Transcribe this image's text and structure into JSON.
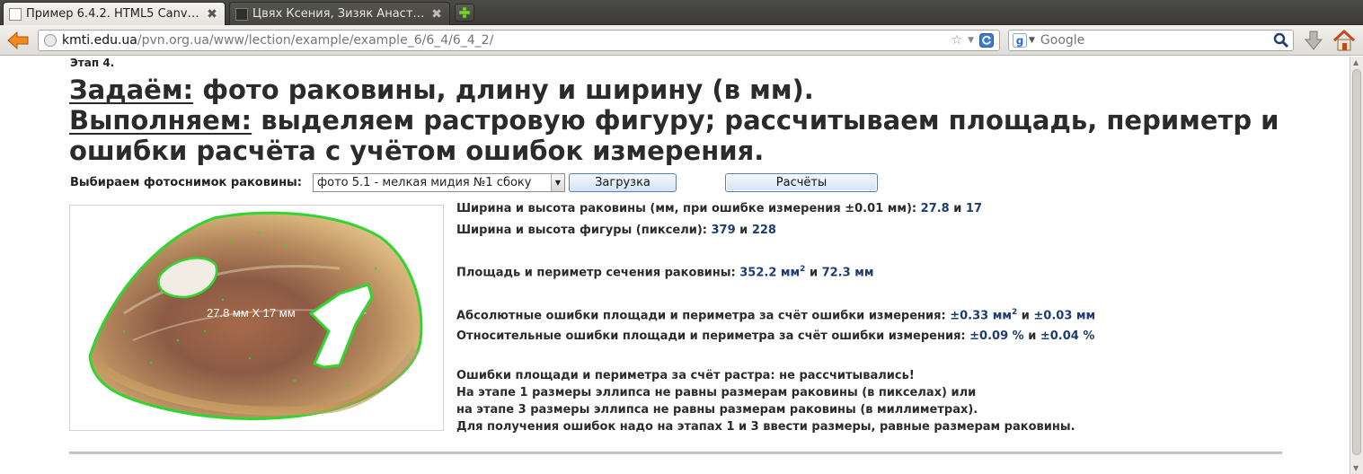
{
  "browser": {
    "tabs": [
      {
        "label": "Пример 6.4.2. HTML5 Canv…",
        "active": true
      },
      {
        "label": "Цвях Ксения, Зизяк Анаст…",
        "active": false
      }
    ],
    "url_host": "kmti.edu.ua",
    "url_path": "/pvn.org.ua/www/lection/example/example_6/6_4/6_4_2/",
    "search_engine": "google-icon",
    "search_placeholder": "Google"
  },
  "page": {
    "stage": "Этап 4.",
    "heading": {
      "task_kw": "Задаём:",
      "task_text": " фото раковины, длину и ширину (в мм).",
      "do_kw": "Выполняем:",
      "do_text": " выделяем растровую фигуру; рассчитываем площадь, периметр и",
      "do_text2": "ошибки расчёта с учётом ошибок измерения."
    },
    "controls": {
      "choose_label": "Выбираем фотоснимок раковины:",
      "selected_photo": "фото 5.1 - мелкая мидия №1 сбоку",
      "load_button": "Загрузка",
      "calc_button": "Расчёты"
    },
    "photo": {
      "overlay_text": "27.8 мм X 17 мм",
      "outline_color": "#2fd62f"
    },
    "results": {
      "shell_size_label": "Ширина и высота раковины (мм, при ошибке измерения ±0.01 мм): ",
      "shell_w": "27.8",
      "and": " и ",
      "shell_h": "17",
      "figure_size_label": "Ширина и высота фигуры (пиксели): ",
      "figure_w": "379",
      "figure_h": "228",
      "area_label": "Площадь и периметр сечения раковины: ",
      "area_val": "352.2 мм",
      "sup2": "2",
      "perimeter_val": "72.3 мм",
      "abs_err_label": "Абсолютные ошибки площади и периметра за счёт ошибки измерения: ",
      "abs_area": "±0.33 мм",
      "abs_perim": "±0.03 мм",
      "rel_err_label": "Относительные ошибки площади и периметра за счёт ошибки измерения: ",
      "rel_area": "±0.09 %",
      "rel_perim": "±0.04 %",
      "raster_note_1": "Ошибки площади и периметра за счёт растра: не рассчитывались!",
      "raster_note_2": "На этапе 1 размеры эллипса не равны размерам раковины (в пикселах) или",
      "raster_note_3": "на этапе 3 размеры эллипса не равны размерам раковины (в миллиметрах).",
      "raster_note_4": "Для получения ошибок надо на этапах 1 и 3 ввести размеры, равные размерам раковины."
    }
  }
}
